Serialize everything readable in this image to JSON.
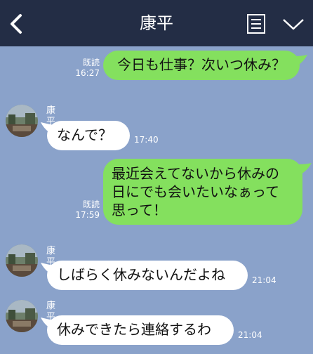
{
  "header": {
    "title": "康平",
    "back_icon": "chevron-left-icon",
    "menu_icon": "menu-list-icon",
    "dropdown_icon": "chevron-down-icon",
    "background": "#232d45"
  },
  "chat": {
    "background": "#8aa2ca",
    "out_bubble_color": "#84e05e",
    "in_bubble_color": "#ffffff",
    "messages": [
      {
        "direction": "out",
        "text_lines": [
          "今日も仕事？次いつ休み？"
        ],
        "read_label": "既読",
        "time": "16:27"
      },
      {
        "direction": "in",
        "sender": "康平",
        "text_lines": [
          "なんで？"
        ],
        "time": "17:40"
      },
      {
        "direction": "out",
        "text_lines": [
          "最近会えてないから休みの",
          "日にでも会いたいなぁって",
          "思って！"
        ],
        "read_label": "既読",
        "time": "17:59"
      },
      {
        "direction": "in",
        "sender": "康平",
        "text_lines": [
          "しばらく休みないんだよね"
        ],
        "time": "21:04"
      },
      {
        "direction": "in",
        "sender": "康平",
        "text_lines": [
          "休みできたら連絡するわ"
        ],
        "time": "21:04"
      }
    ]
  }
}
